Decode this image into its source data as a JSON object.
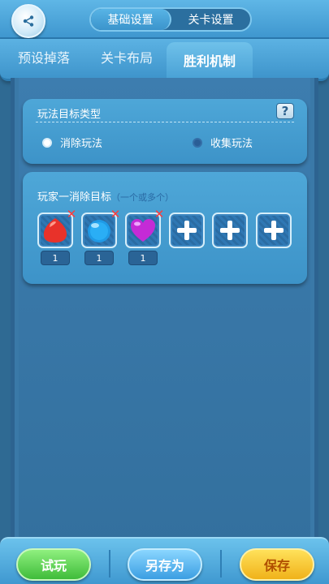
{
  "top_tabs": [
    {
      "label": "基础设置",
      "active": false
    },
    {
      "label": "关卡设置",
      "active": true
    }
  ],
  "sub_tabs": [
    {
      "label": "预设掉落"
    },
    {
      "label": "关卡布局"
    },
    {
      "label": "胜利机制",
      "active": true
    }
  ],
  "mode_card": {
    "title": "玩法目标类型",
    "help": "?",
    "options": [
      {
        "label": "消除玩法",
        "selected": true
      },
      {
        "label": "收集玩法",
        "selected": false
      }
    ]
  },
  "goal_card": {
    "title": "玩家一消除目标",
    "subtitle": "（一个或多个）",
    "remove_symbol": "✕",
    "targets": [
      {
        "gem": "red-gem-icon",
        "count": "1",
        "color": "#e8322a"
      },
      {
        "gem": "blue-gem-icon",
        "count": "1",
        "color": "#1f9ae6"
      },
      {
        "gem": "purple-heart-icon",
        "count": "1",
        "color": "#c42bd6"
      }
    ],
    "add_slots": 3
  },
  "bottom_bar": {
    "try_label": "试玩",
    "save_as_label": "另存为",
    "save_label": "保存"
  }
}
